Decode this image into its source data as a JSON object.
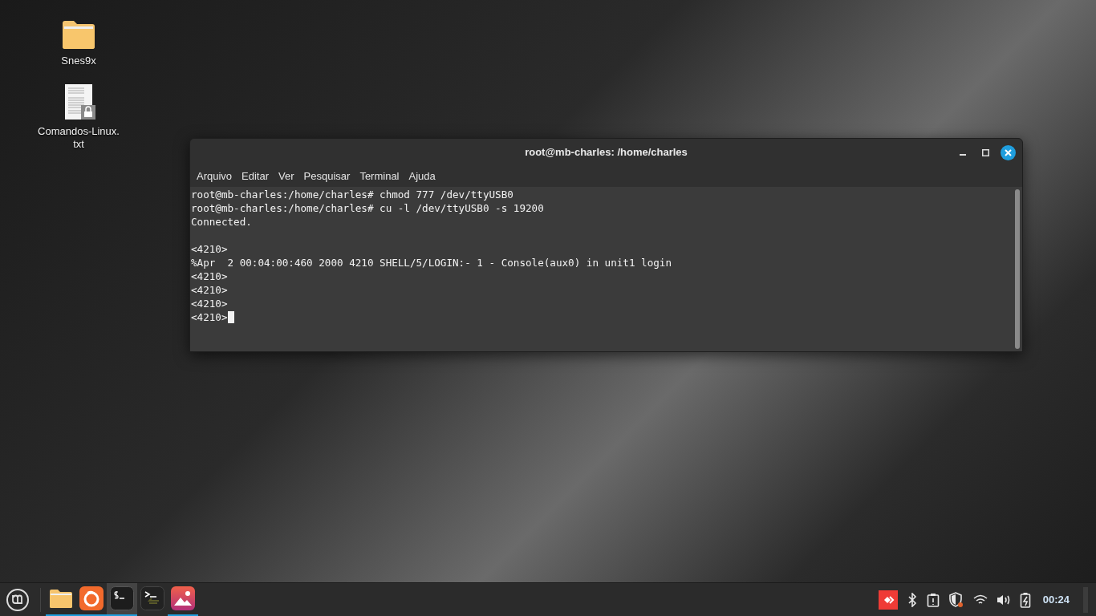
{
  "desktop_icons": [
    {
      "kind": "folder",
      "label": "Snes9x"
    },
    {
      "kind": "text-file",
      "label": "Comandos-Linux.\ntxt",
      "locked": true
    }
  ],
  "window": {
    "title": "root@mb-charles: /home/charles",
    "menu": [
      "Arquivo",
      "Editar",
      "Ver",
      "Pesquisar",
      "Terminal",
      "Ajuda"
    ],
    "blocks": [
      [
        "root@mb-charles:/home/charles# chmod 777 /dev/ttyUSB0",
        "root@mb-charles:/home/charles# cu -l /dev/ttyUSB0 -s 19200",
        "Connected."
      ],
      [
        "<4210>",
        "%Apr  2 00:04:00:460 2000 4210 SHELL/5/LOGIN:- 1 - Console(aux0) in unit1 login",
        "<4210>",
        "<4210>",
        "<4210>",
        "<4210>"
      ]
    ]
  },
  "taskbar": {
    "apps": [
      {
        "kind": "folder",
        "running": true,
        "selected": false
      },
      {
        "kind": "browser",
        "running": true,
        "selected": false
      },
      {
        "kind": "terminal",
        "running": true,
        "selected": true
      },
      {
        "kind": "terminal-alt",
        "running": false,
        "selected": false
      },
      {
        "kind": "photos",
        "running": true,
        "selected": false
      }
    ],
    "clock": "00:24"
  }
}
